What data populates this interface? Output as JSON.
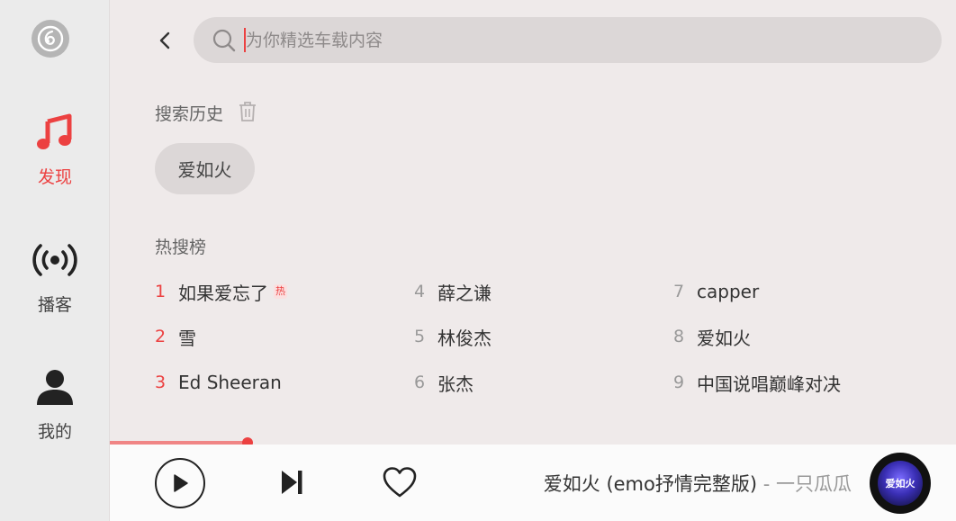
{
  "sidebar": {
    "logo_icon": "netease-music-logo",
    "items": [
      {
        "label": "发现",
        "icon": "music-note-icon",
        "active": true
      },
      {
        "label": "播客",
        "icon": "broadcast-icon",
        "active": false
      },
      {
        "label": "我的",
        "icon": "user-icon",
        "active": false
      }
    ]
  },
  "search": {
    "placeholder": "为你精选车载内容",
    "value": ""
  },
  "history": {
    "title": "搜索历史",
    "items": [
      "爱如火"
    ]
  },
  "hot": {
    "title": "热搜榜",
    "items": [
      {
        "rank": "1",
        "name": "如果爱忘了",
        "badge": "热"
      },
      {
        "rank": "2",
        "name": "雪"
      },
      {
        "rank": "3",
        "name": "Ed Sheeran"
      },
      {
        "rank": "4",
        "name": "薛之谦"
      },
      {
        "rank": "5",
        "name": "林俊杰"
      },
      {
        "rank": "6",
        "name": "张杰"
      },
      {
        "rank": "7",
        "name": "capper"
      },
      {
        "rank": "8",
        "name": "爱如火"
      },
      {
        "rank": "9",
        "name": "中国说唱巅峰对决"
      }
    ]
  },
  "player": {
    "progress": 0.163,
    "song": "爱如火 (emo抒情完整版)",
    "separator": " - ",
    "artist": "一只瓜瓜",
    "album_text": "爱如火"
  },
  "colors": {
    "accent": "#ec4141",
    "sidebar_bg": "#ebebeb",
    "main_bg": "#efeaea"
  }
}
